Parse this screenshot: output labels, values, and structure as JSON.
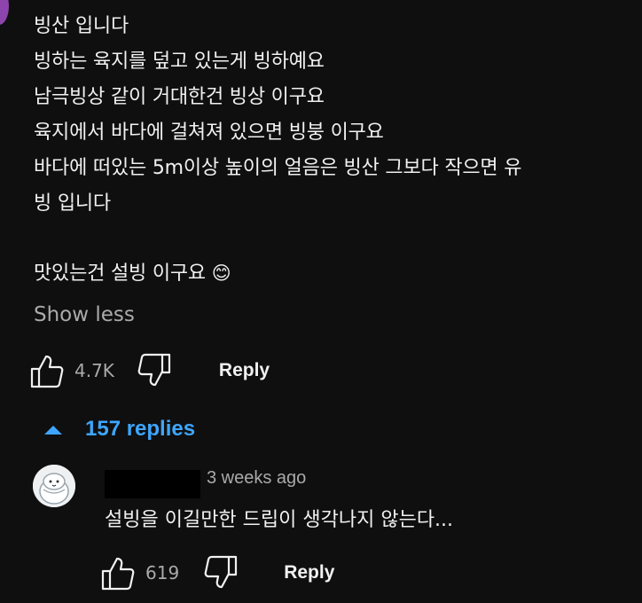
{
  "comment": {
    "lines": [
      "빙산 입니다",
      "빙하는 육지를 덮고 있는게 빙하예요",
      "남극빙상 같이 거대한건 빙상 이구요",
      "육지에서 바다에 걸쳐져 있으면 빙붕 이구요",
      "바다에 떠있는 5m이상 높이의 얼음은 빙산 그보다 작으면 유",
      "빙 입니다"
    ],
    "last_line": "맛있는건 설빙 이구요",
    "emoji": "😊",
    "show_less_label": "Show less",
    "like_count": "4.7K",
    "reply_label": "Reply"
  },
  "replies_toggle": {
    "label": "157 replies",
    "icon": "caret-up-icon",
    "accent_color": "#3ea6ff"
  },
  "reply": {
    "timestamp": "3 weeks ago",
    "text": "설빙을 이길만한 드립이 생각나지 않는다...",
    "like_count": "619",
    "reply_label": "Reply"
  },
  "colors": {
    "background": "#0f0f0f",
    "text": "#f1f1f1",
    "secondary_text": "#aaaaaa"
  }
}
